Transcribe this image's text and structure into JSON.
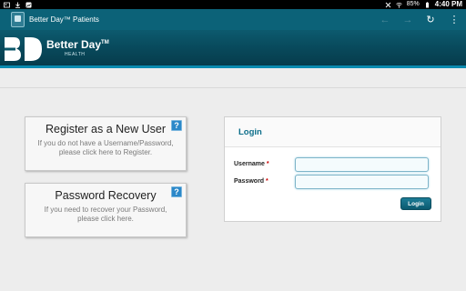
{
  "status_bar": {
    "battery": "85%",
    "time": "4:40 PM",
    "left_icons": [
      "photo-icon",
      "download-icon",
      "gallery-icon"
    ],
    "right_icons": [
      "mute-icon",
      "wifi-icon",
      "battery-icon"
    ]
  },
  "action_bar": {
    "title": "Better Day™ Patients",
    "back_glyph": "←",
    "forward_glyph": "→",
    "refresh_glyph": "↻",
    "menu_glyph": "⋮"
  },
  "banner": {
    "brand": "Better Day",
    "tm": "TM",
    "subtitle": "HEALTH"
  },
  "register_card": {
    "title": "Register as a New User",
    "description": "If you do not have a Username/Password, please click here to Register.",
    "help": "?"
  },
  "recovery_card": {
    "title": "Password Recovery",
    "description": "If you need to recover your Password, please click here.",
    "help": "?"
  },
  "login": {
    "title": "Login",
    "username_label": "Username",
    "password_label": "Password",
    "required_mark": "*",
    "username_value": "",
    "password_value": "",
    "button_label": "Login"
  },
  "colors": {
    "action_bar": "#0c6278",
    "banner": "#08485a",
    "accent": "#0a8bb0",
    "help_icon": "#2b88c9"
  }
}
